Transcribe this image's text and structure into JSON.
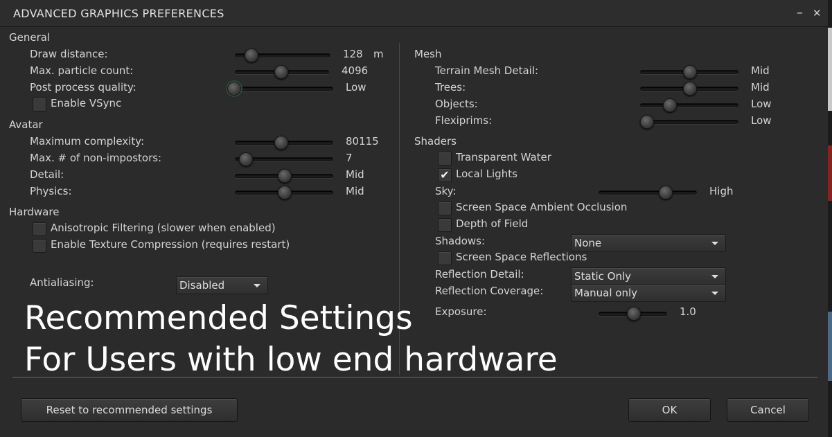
{
  "window": {
    "title": "ADVANCED GRAPHICS PREFERENCES",
    "minimize_glyph": "–",
    "close_glyph": "✕"
  },
  "general": {
    "heading": "General",
    "draw_distance": {
      "label": "Draw distance:",
      "value": "128",
      "unit": "m",
      "fraction": 0.12
    },
    "max_particle": {
      "label": "Max. particle count:",
      "value": "4096",
      "fraction": 0.48
    },
    "post_process": {
      "label": "Post process quality:",
      "value": "Low",
      "fraction": 0.0
    },
    "vsync": {
      "label": "Enable VSync",
      "checked": false
    }
  },
  "avatar": {
    "heading": "Avatar",
    "max_complexity": {
      "label": "Maximum complexity:",
      "value": "80115",
      "fraction": 0.46
    },
    "non_impostors": {
      "label": "Max. # of non-impostors:",
      "value": "7",
      "fraction": 0.05
    },
    "detail": {
      "label": "Detail:",
      "value": "Mid",
      "fraction": 0.5
    },
    "physics": {
      "label": "Physics:",
      "value": "Mid",
      "fraction": 0.5
    }
  },
  "hardware": {
    "heading": "Hardware",
    "anisotropic": {
      "label": "Anisotropic Filtering (slower when enabled)",
      "checked": false
    },
    "texture_compression": {
      "label": "Enable Texture Compression (requires restart)",
      "checked": false
    },
    "antialiasing": {
      "label": "Antialiasing:",
      "value": "Disabled"
    }
  },
  "mesh": {
    "heading": "Mesh",
    "terrain": {
      "label": "Terrain Mesh Detail:",
      "value": "Mid",
      "fraction": 0.5
    },
    "trees": {
      "label": "Trees:",
      "value": "Mid",
      "fraction": 0.5
    },
    "objects": {
      "label": "Objects:",
      "value": "Low",
      "fraction": 0.27
    },
    "flexiprims": {
      "label": "Flexiprims:",
      "value": "Low",
      "fraction": 0.0
    }
  },
  "shaders": {
    "heading": "Shaders",
    "transparent_water": {
      "label": "Transparent Water",
      "checked": false
    },
    "local_lights": {
      "label": "Local Lights",
      "checked": true,
      "check_glyph": "✔"
    },
    "sky": {
      "label": "Sky:",
      "value": "High",
      "fraction": 0.7
    },
    "ssao": {
      "label": "Screen Space Ambient Occlusion",
      "checked": false
    },
    "dof": {
      "label": "Depth of Field",
      "checked": false
    },
    "shadows": {
      "label": "Shadows:",
      "value": "None"
    },
    "ssr": {
      "label": "Screen Space Reflections",
      "checked": false
    },
    "reflection_detail": {
      "label": "Reflection Detail:",
      "value": "Static Only"
    },
    "reflection_coverage": {
      "label": "Reflection Coverage:",
      "value": "Manual only"
    },
    "exposure": {
      "label": "Exposure:",
      "value": "1.0",
      "fraction": 0.5
    }
  },
  "overlay": {
    "line1": "Recommended Settings",
    "line2": "For Users with low end hardware"
  },
  "footer": {
    "reset_label": "Reset to recommended settings",
    "ok_label": "OK",
    "cancel_label": "Cancel"
  }
}
